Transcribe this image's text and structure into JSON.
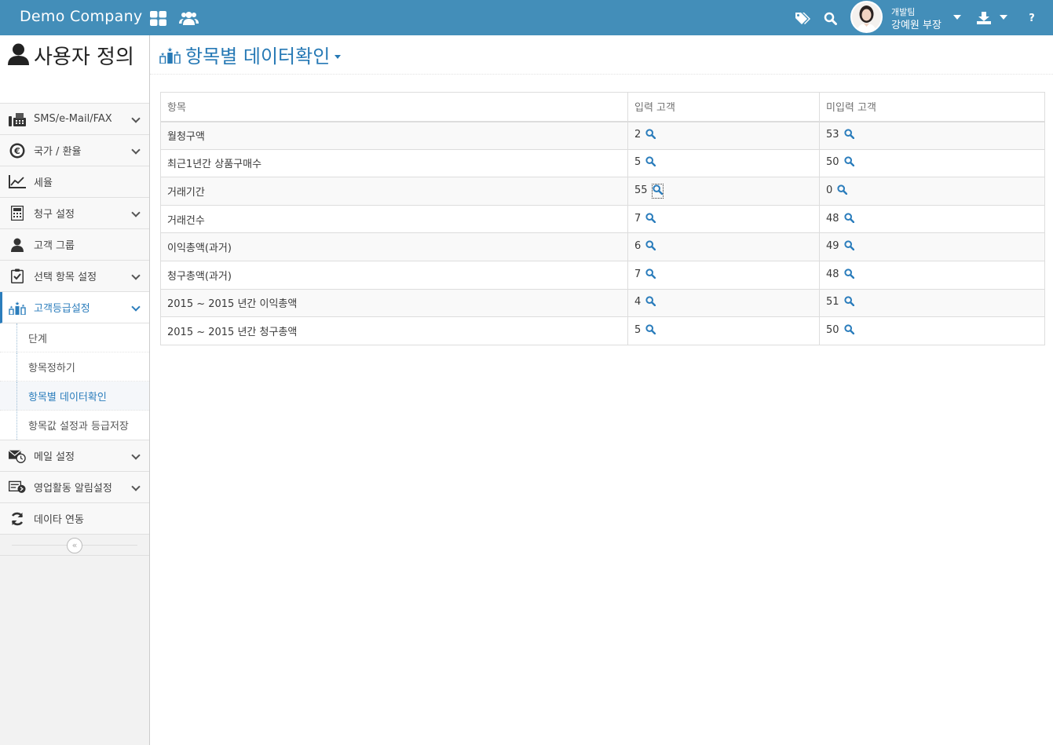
{
  "navbar": {
    "brand": "Demo Company",
    "user": {
      "team": "개발팀",
      "name": "강예원 부장"
    },
    "help_label": "?"
  },
  "sidebar": {
    "title": "사용자 정의",
    "items": [
      {
        "label": "SMS/e-Mail/FAX",
        "icon": "fax-icon"
      },
      {
        "label": "국가 / 환율",
        "icon": "euro-icon"
      },
      {
        "label": "세율",
        "icon": "line-chart-icon"
      },
      {
        "label": "청구 설정",
        "icon": "calculator-icon"
      },
      {
        "label": "고객 그룹",
        "icon": "user-icon"
      },
      {
        "label": "선택 항목 설정",
        "icon": "clipboard-check-icon"
      },
      {
        "label": "고객등급설정",
        "icon": "ranking-icon",
        "active": true
      },
      {
        "label": "메일 설정",
        "icon": "mail-clock-icon"
      },
      {
        "label": "영업활동 알림설정",
        "icon": "notification-icon"
      },
      {
        "label": "데이타 연동",
        "icon": "refresh-icon"
      }
    ],
    "submenu": [
      {
        "label": "단계"
      },
      {
        "label": "항목정하기"
      },
      {
        "label": "항목별 데이터확인",
        "active": true
      },
      {
        "label": "항목값 설정과 등급저장"
      }
    ],
    "collapse_label": "«"
  },
  "page": {
    "title": "항목별 데이터확인"
  },
  "table": {
    "headers": [
      "항목",
      "입력 고객",
      "미입력 고객"
    ],
    "rows": [
      {
        "item": "월청구액",
        "input": "2",
        "missing": "53"
      },
      {
        "item": "최근1년간 상품구매수",
        "input": "5",
        "missing": "50"
      },
      {
        "item": "거래기간",
        "input": "55",
        "missing": "0"
      },
      {
        "item": "거래건수",
        "input": "7",
        "missing": "48"
      },
      {
        "item": "이익총액(과거)",
        "input": "6",
        "missing": "49"
      },
      {
        "item": "청구총액(과거)",
        "input": "7",
        "missing": "48"
      },
      {
        "item": "2015 ~ 2015 년간 이익총액",
        "input": "4",
        "missing": "51"
      },
      {
        "item": "2015 ~ 2015 년간 청구총액",
        "input": "5",
        "missing": "50"
      }
    ]
  },
  "colors": {
    "navbar": "#438eb9",
    "accent": "#2679b5",
    "search_icon": "#2b7dbc"
  }
}
